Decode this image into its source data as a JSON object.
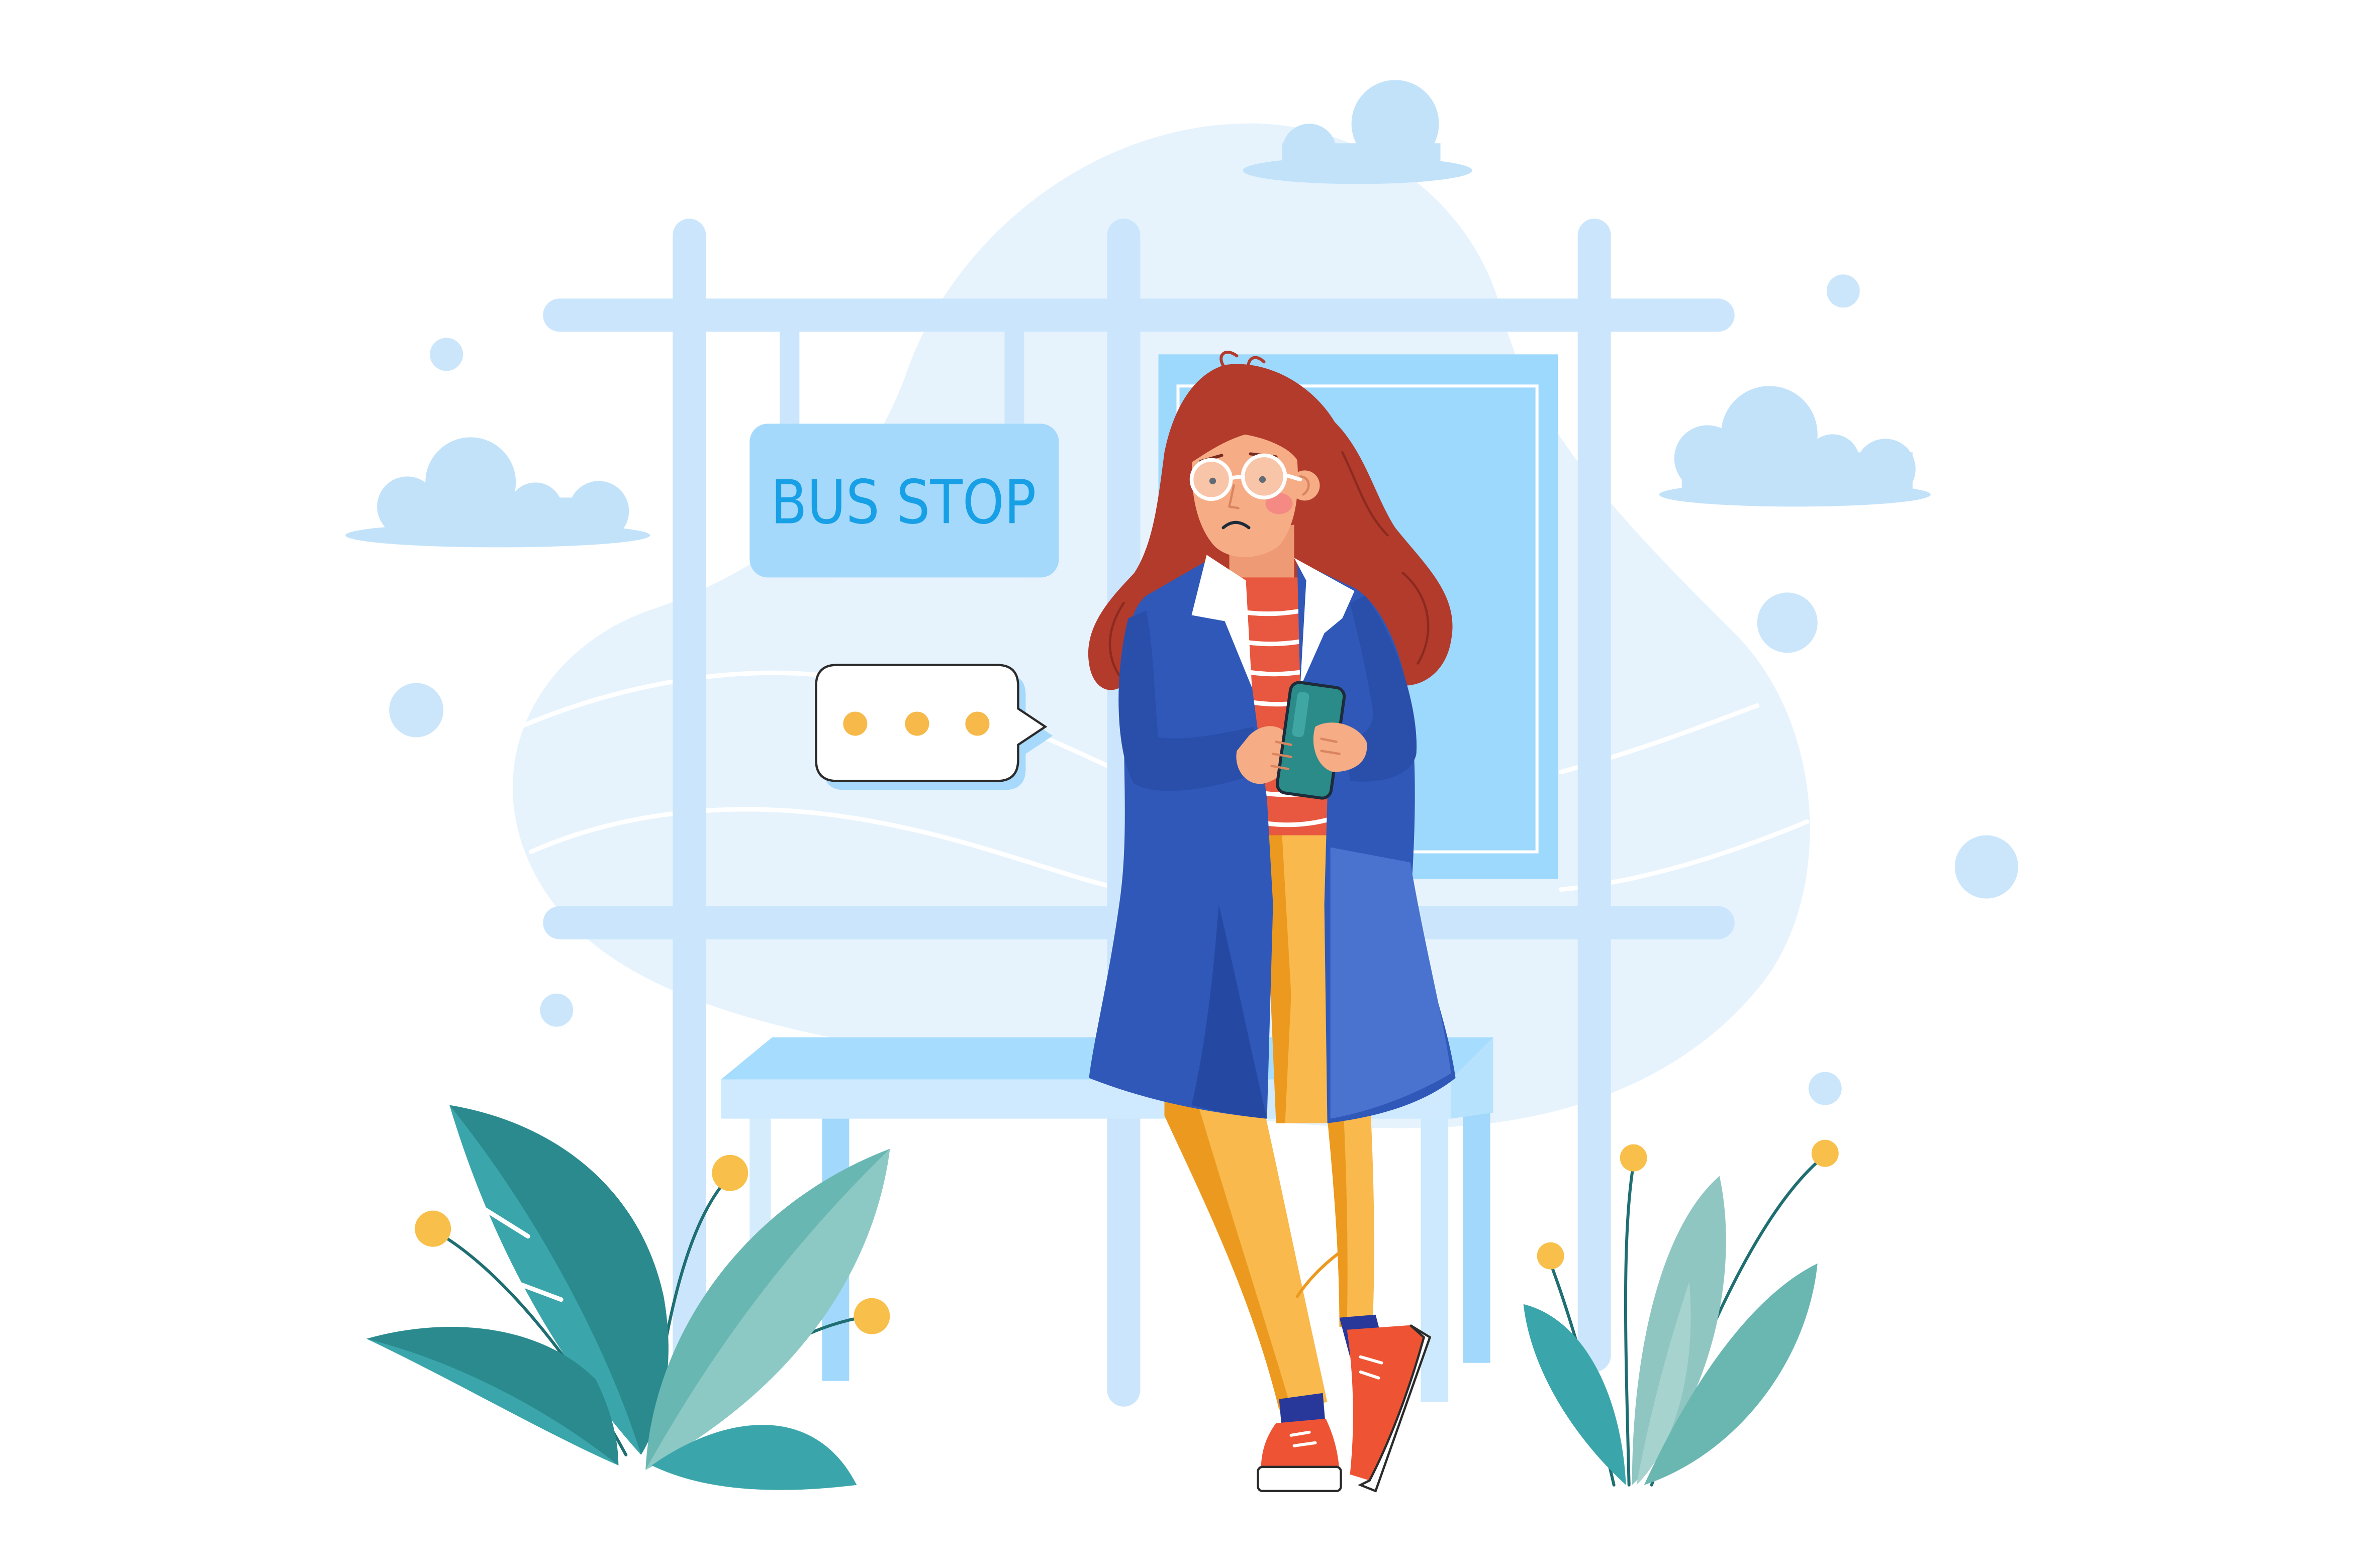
{
  "sign": {
    "label": "BUS STOP"
  },
  "speech_bubble": {
    "icon": "typing-dots-icon"
  },
  "colors": {
    "background": "#ffffff",
    "sky_blob": "#e6f3fd",
    "cloud": "#c2e2fa",
    "sky_dot": "#cbe6fb",
    "structure": "#cbe6fc",
    "sign_fill": "#a4d9fc",
    "sign_text": "#18a0e6",
    "poster": "#9dd8fd",
    "bench_top": "#a6dcfd",
    "coat": "#2f58b8",
    "hair": "#b23b2c",
    "shirt": "#e8573f",
    "skin": "#f6ac85",
    "pants": "#f9b94c",
    "socks": "#27389a",
    "shoes": "#ee5434",
    "phone": "#2b8b89",
    "leaf": "#3aa6ab",
    "flower": "#f8c04a",
    "bubble_dot": "#f6b94a"
  }
}
